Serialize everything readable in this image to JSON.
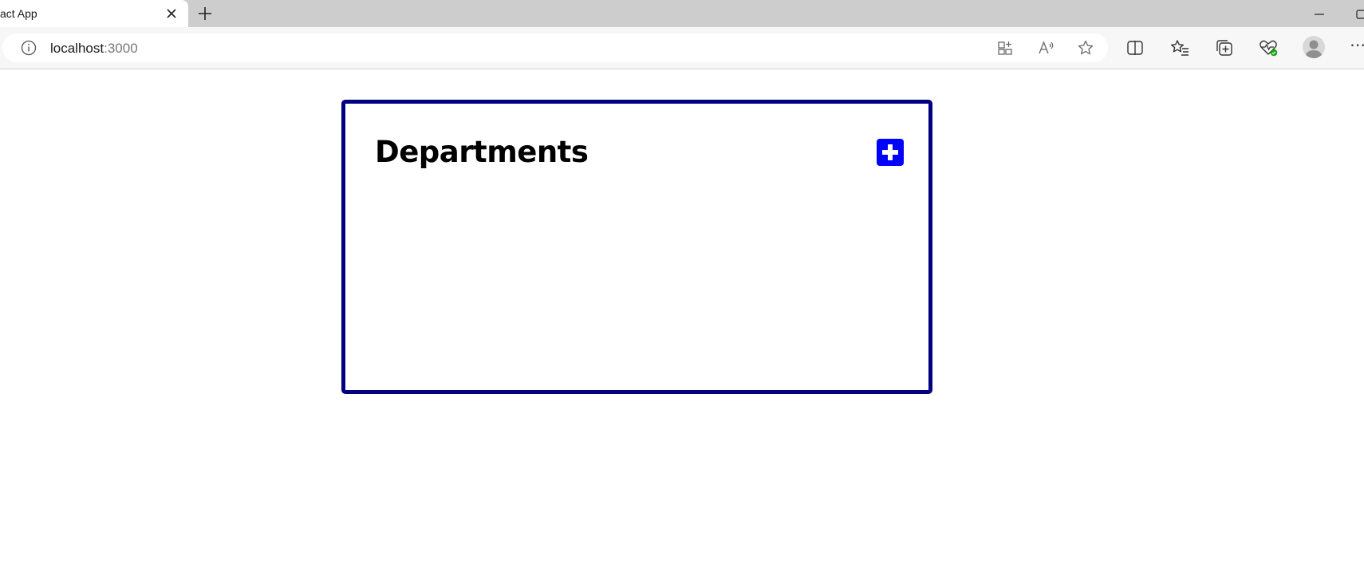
{
  "browser": {
    "tab": {
      "title": "act App"
    },
    "address_bar": {
      "host": "localhost",
      "port": ":3000"
    }
  },
  "page": {
    "card": {
      "title": "Departments",
      "add_button_icon": "plus-icon"
    }
  },
  "colors": {
    "card_border": "#000080",
    "add_button": "#0000ff",
    "tab_strip": "#cdcdcd"
  }
}
